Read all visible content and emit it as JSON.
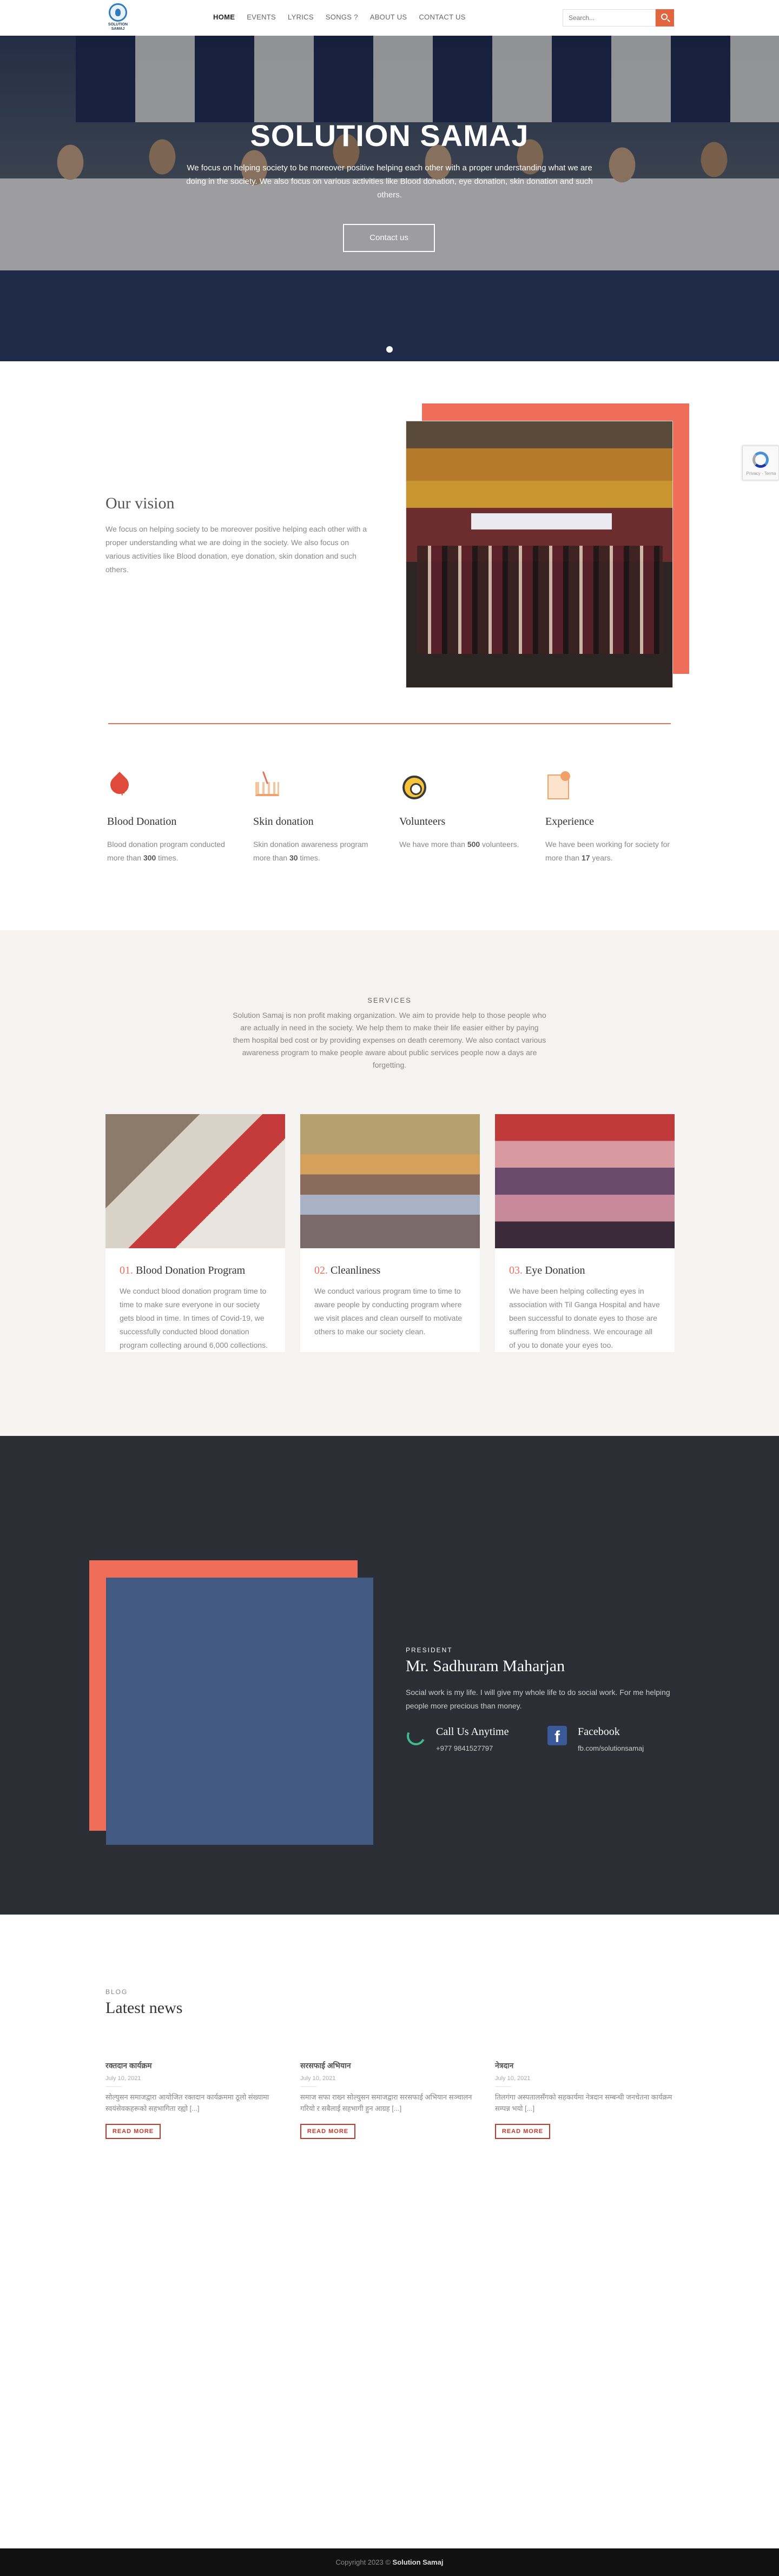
{
  "header": {
    "logo_text": "SOLUTION SAMAJ",
    "nav": [
      "HOME",
      "EVENTS",
      "LYRICS",
      "SONGS ?",
      "ABOUT US",
      "CONTACT US"
    ],
    "search_placeholder": "Search..."
  },
  "hero": {
    "title": "SOLUTION SAMAJ",
    "description": "We focus on helping society to be moreover positive helping each other with a proper understanding what we are doing in the society. We also focus on various activities like Blood donation, eye donation, skin donation and such others.",
    "button": "Contact us"
  },
  "vision": {
    "title": "Our vision",
    "text": "We focus on helping society to be moreover positive helping each other with a proper understanding what we are doing in the society. We also focus on various activities like Blood donation, eye donation, skin donation and such others."
  },
  "features": [
    {
      "title": "Blood Donation",
      "text_before": "Blood donation program conducted more than ",
      "value": "300",
      "text_after": " times."
    },
    {
      "title": "Skin donation",
      "text_before": "Skin donation awareness program more than ",
      "value": "30",
      "text_after": " times."
    },
    {
      "title": "Volunteers",
      "text_before": "We have more than ",
      "value": "500",
      "text_after": " volunteers."
    },
    {
      "title": "Experience",
      "text_before": "We have been working for society for more than ",
      "value": "17",
      "text_after": " years."
    }
  ],
  "services": {
    "label": "SERVICES",
    "description": "Solution Samaj is non profit making organization. We aim to provide help to those people who are actually in need in the society. We help them to make their life easier either by paying them hospital bed cost or by providing expenses on death ceremony. We also contact various awareness program to make people aware about public services people now a days are forgetting.",
    "cards": [
      {
        "num": "01.",
        "title": "Blood Donation Program",
        "text": "We conduct blood donation program time to time to make sure everyone in our society gets blood in time. In times of Covid-19, we successfully conducted blood donation program collecting around 6,000 collections."
      },
      {
        "num": "02.",
        "title": "Cleanliness",
        "text": "We conduct various program time to time to aware people by conducting program where we visit places and clean ourself to motivate others to make our society clean."
      },
      {
        "num": "03.",
        "title": "Eye Donation",
        "text": "We have been helping collecting eyes in association with Til Ganga Hospital and have been successful to donate eyes to those are suffering from blindness. We encourage all of you to donate your eyes too."
      }
    ]
  },
  "president": {
    "label": "PRESIDENT",
    "name": "Mr. Sadhuram Maharjan",
    "text": "Social work is my life. I will give my whole life to do social work. For me helping people more precious than money.",
    "call_title": "Call Us Anytime",
    "call_value": "+977 9841527797",
    "fb_title": "Facebook",
    "fb_value": "fb.com/solutionsamaj"
  },
  "blog": {
    "label": "BLOG",
    "title": "Latest news",
    "posts": [
      {
        "title": "रक्तदान कार्यक्रम",
        "date": "July 10, 2021",
        "excerpt": "सोल्युसन समाजद्वारा आयोजित रक्तदान कार्यक्रममा ठूलो संख्यामा स्वयंसेवकहरूको सहभागिता रह्यो [...]",
        "button": "READ MORE"
      },
      {
        "title": "सरसफाई अभियान",
        "date": "July 10, 2021",
        "excerpt": "समाज सफा राख्न सोल्युसन समाजद्वारा सरसफाई अभियान सञ्चालन गरियो र सबैलाई सहभागी हुन आग्रह [...]",
        "button": "READ MORE"
      },
      {
        "title": "नेत्रदान",
        "date": "July 10, 2021",
        "excerpt": "तिलगंगा अस्पतालसँगको सहकार्यमा नेत्रदान सम्बन्धी जनचेतना कार्यक्रम सम्पन्न भयो [...]",
        "button": "READ MORE"
      }
    ]
  },
  "footer": {
    "text_before": "Copyright 2023 © ",
    "brand": "Solution Samaj"
  },
  "recaptcha": {
    "text": "Privacy - Terms"
  }
}
